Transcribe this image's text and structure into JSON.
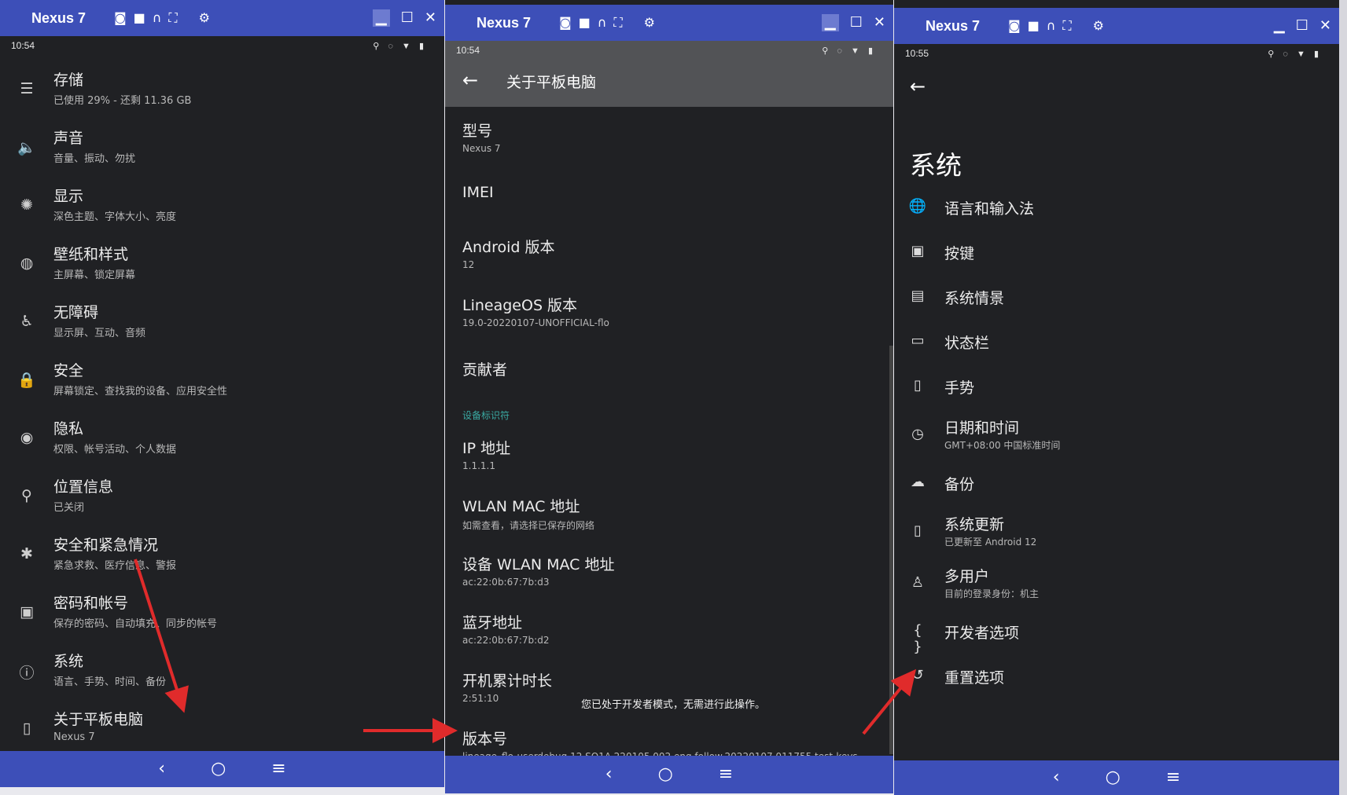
{
  "colors": {
    "accent": "#3d4fb8",
    "surface": "#202124",
    "section_header": "#3aa9a2",
    "arrow": "#e02b2b"
  },
  "window_titlebar": {
    "name": "Nexus 7",
    "icons": [
      "camera-icon",
      "video-icon",
      "headphones-icon",
      "fullscreen-icon",
      "settings-gear-icon"
    ],
    "controls": [
      "minimize-icon",
      "maximize-icon",
      "close-icon"
    ]
  },
  "navigation_bar": [
    "back-icon",
    "home-icon",
    "recents-icon"
  ],
  "panels": {
    "settings": {
      "time": "10:54",
      "items": [
        {
          "icon": "storage-icon",
          "title": "存储",
          "subtitle": "已使用 29% - 还剩 11.36 GB"
        },
        {
          "icon": "sound-icon",
          "title": "声音",
          "subtitle": "音量、振动、勿扰"
        },
        {
          "icon": "display-icon",
          "title": "显示",
          "subtitle": "深色主题、字体大小、亮度"
        },
        {
          "icon": "palette-icon",
          "title": "壁纸和样式",
          "subtitle": "主屏幕、锁定屏幕"
        },
        {
          "icon": "accessibility-icon",
          "title": "无障碍",
          "subtitle": "显示屏、互动、音频"
        },
        {
          "icon": "lock-icon",
          "title": "安全",
          "subtitle": "屏幕锁定、查找我的设备、应用安全性"
        },
        {
          "icon": "privacy-eye-icon",
          "title": "隐私",
          "subtitle": "权限、帐号活动、个人数据"
        },
        {
          "icon": "location-pin-icon",
          "title": "位置信息",
          "subtitle": "已关闭"
        },
        {
          "icon": "emergency-asterisk-icon",
          "title": "安全和紧急情况",
          "subtitle": "紧急求救、医疗信息、警报"
        },
        {
          "icon": "account-box-icon",
          "title": "密码和帐号",
          "subtitle": "保存的密码、自动填充、同步的帐号"
        },
        {
          "icon": "info-icon",
          "title": "系统",
          "subtitle": "语言、手势、时间、备份"
        },
        {
          "icon": "tablet-icon",
          "title": "关于平板电脑",
          "subtitle": "Nexus 7"
        }
      ]
    },
    "about": {
      "time": "10:54",
      "title": "关于平板电脑",
      "items": [
        {
          "title": "型号",
          "subtitle": "Nexus 7"
        },
        {
          "title": "IMEI",
          "subtitle": ""
        },
        {
          "title": "Android 版本",
          "subtitle": "12"
        },
        {
          "title": "LineageOS 版本",
          "subtitle": "19.0-20220107-UNOFFICIAL-flo"
        },
        {
          "title": "贡献者",
          "subtitle": ""
        }
      ],
      "section_header": "设备标识符",
      "identifiers": [
        {
          "title": "IP 地址",
          "subtitle": "1.1.1.1"
        },
        {
          "title": "WLAN MAC 地址",
          "subtitle": "如需查看，请选择已保存的网络"
        },
        {
          "title": "设备 WLAN MAC 地址",
          "subtitle": "ac:22:0b:67:7b:d3"
        },
        {
          "title": "蓝牙地址",
          "subtitle": "ac:22:0b:67:7b:d2"
        },
        {
          "title": "开机累计时长",
          "subtitle": "2:51:10"
        },
        {
          "title": "版本号",
          "subtitle": "lineage_flo-userdebug 12 SQ1A.220105.002 eng.follow.20220107.011755 test-keys"
        }
      ],
      "toast": "您已处于开发者模式，无需进行此操作。"
    },
    "system": {
      "time": "10:55",
      "title": "系统",
      "items": [
        {
          "icon": "globe-icon",
          "title": "语言和输入法",
          "subtitle": ""
        },
        {
          "icon": "fn-key-icon",
          "title": "按键",
          "subtitle": ""
        },
        {
          "icon": "system-scene-icon",
          "title": "系统情景",
          "subtitle": ""
        },
        {
          "icon": "statusbar-icon",
          "title": "状态栏",
          "subtitle": ""
        },
        {
          "icon": "gesture-phone-icon",
          "title": "手势",
          "subtitle": ""
        },
        {
          "icon": "clock-icon",
          "title": "日期和时间",
          "subtitle": "GMT+08:00 中国标准时间"
        },
        {
          "icon": "cloud-backup-icon",
          "title": "备份",
          "subtitle": ""
        },
        {
          "icon": "system-update-icon",
          "title": "系统更新",
          "subtitle": "已更新至 Android 12"
        },
        {
          "icon": "person-icon",
          "title": "多用户",
          "subtitle": "目前的登录身份：机主"
        },
        {
          "icon": "developer-braces-icon",
          "title": "开发者选项",
          "subtitle": ""
        },
        {
          "icon": "history-reset-icon",
          "title": "重置选项",
          "subtitle": ""
        }
      ]
    }
  }
}
